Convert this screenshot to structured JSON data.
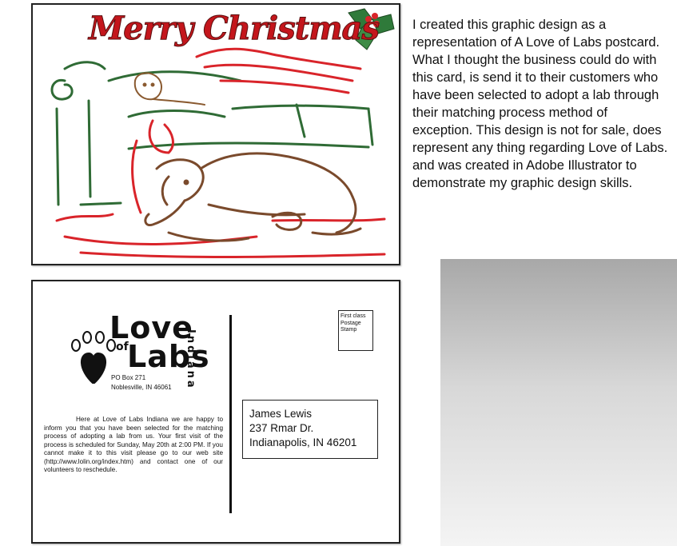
{
  "front_card": {
    "title": "Merry Christmas"
  },
  "description": "I created this graphic design as a representation of A Love of Labs postcard.  What I thought the business could do with this card, is send it to their customers who have been selected to adopt a lab through their matching process method of exception.  This design is not for sale, does represent any thing regarding Love of Labs. and was created in Adobe Illustrator to demonstrate my graphic design skills.",
  "back_card": {
    "logo": {
      "love": "Love",
      "of": "of",
      "labs": "Labs",
      "state": "Indiana"
    },
    "po_box": "PO Box 271",
    "city": "Noblesville, IN 46061",
    "message": "Here at Love of Labs Indiana we are happy to inform you that you have been selected for the matching process of adopting a lab from us.  Your first visit of the process is scheduled for Sunday, May 20th at 2:00 PM.  If you cannot make it to this visit please go to our web site (http://www.lolin.org/index.htm) and contact one of our volunteers to reschedule.",
    "stamp": [
      "First class",
      "Postage",
      "Stamp"
    ],
    "address": {
      "name": "James Lewis",
      "street": "237 Rmar Dr.",
      "city": "Indianapolis, IN 46201"
    }
  },
  "colors": {
    "red": "#d9242a",
    "green": "#2f6b35",
    "brown": "#7a4a2c",
    "outline": "#222222"
  }
}
